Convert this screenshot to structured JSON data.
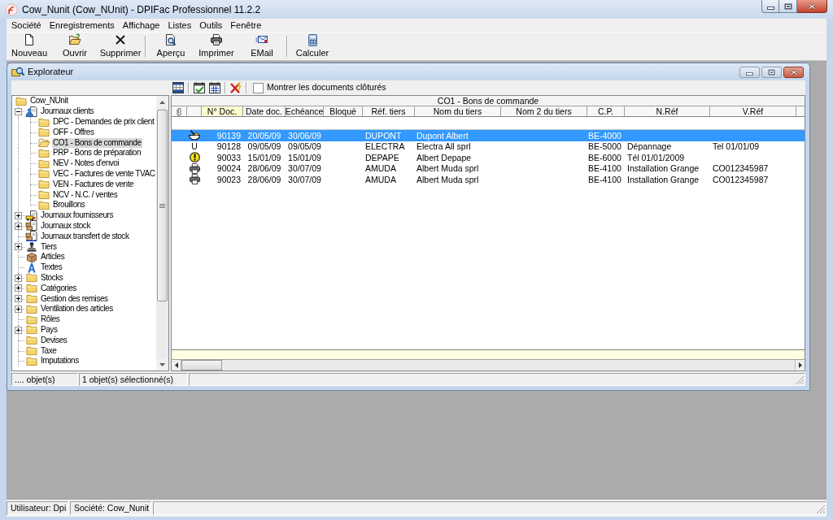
{
  "window": {
    "title": "Cow_Nunit (Cow_NUnit) - DPIFac Professionnel 11.2.2"
  },
  "menu": [
    "Société",
    "Enregistrements",
    "Affichage",
    "Listes",
    "Outils",
    "Fenêtre"
  ],
  "toolbar": [
    [
      {
        "label": "Nouveau",
        "kind": "new"
      },
      {
        "label": "Ouvrir",
        "kind": "open"
      },
      {
        "label": "Supprimer",
        "kind": "delete"
      }
    ],
    [
      {
        "label": "Aperçu",
        "kind": "preview"
      },
      {
        "label": "Imprimer",
        "kind": "print"
      },
      {
        "label": "EMail",
        "kind": "email"
      }
    ],
    [
      {
        "label": "Calculer",
        "kind": "calculator"
      }
    ]
  ],
  "explorer": {
    "title": "Explorateur",
    "toolbar": {
      "show_closed": {
        "label": "Montrer les documents clôturés",
        "checked": false
      }
    },
    "tree": [
      {
        "label": "Cow_NUnit",
        "kind": "folder",
        "selected": false,
        "children": [
          {
            "label": "Journaux clients",
            "kind": "customers",
            "expanded": true,
            "selected": false,
            "children": [
              {
                "label": "DPC - Demandes de prix client",
                "kind": "folder",
                "selected": false
              },
              {
                "label": "OFF - Offres",
                "kind": "folder",
                "selected": false
              },
              {
                "label": "CO1 - Bons de commande",
                "kind": "folder",
                "selected": true
              },
              {
                "label": "PRP - Bons de préparation",
                "kind": "folder",
                "selected": false
              },
              {
                "label": "NEV - Notes d'envoi",
                "kind": "folder",
                "selected": false
              },
              {
                "label": "VEC - Factures de vente TVAC",
                "kind": "folder",
                "selected": false
              },
              {
                "label": "VEN - Factures de vente",
                "kind": "folder",
                "selected": false
              },
              {
                "label": "NCV - N.C. / ventes",
                "kind": "folder",
                "selected": false
              },
              {
                "label": "Brouillons",
                "kind": "folder",
                "selected": false
              }
            ]
          },
          {
            "label": "Journaux fournisseurs",
            "kind": "suppliers",
            "expanded": false,
            "selected": false
          },
          {
            "label": "Journaux stock",
            "kind": "stock",
            "expanded": false,
            "selected": false
          },
          {
            "label": "Journaux transfert de stock",
            "kind": "transfer",
            "selected": false
          },
          {
            "label": "Tiers",
            "kind": "contacts",
            "expanded": false,
            "selected": false
          },
          {
            "label": "Articles",
            "kind": "articles",
            "selected": false
          },
          {
            "label": "Textes",
            "kind": "texts",
            "selected": false
          },
          {
            "label": "Stocks",
            "kind": "folder",
            "expanded": false,
            "selected": false
          },
          {
            "label": "Catégories",
            "kind": "folder",
            "expanded": false,
            "selected": false
          },
          {
            "label": "Gestion des remises",
            "kind": "folder",
            "expanded": false,
            "selected": false
          },
          {
            "label": "Ventilation des articles",
            "kind": "folder",
            "expanded": false,
            "selected": false
          },
          {
            "label": "Rôles",
            "kind": "folder",
            "selected": false
          },
          {
            "label": "Pays",
            "kind": "folder",
            "expanded": false,
            "selected": false
          },
          {
            "label": "Devises",
            "kind": "folder",
            "selected": false
          },
          {
            "label": "Taxe",
            "kind": "folder",
            "selected": false
          },
          {
            "label": "Imputations",
            "kind": "folder",
            "selected": false
          }
        ]
      }
    ],
    "grid": {
      "title": "CO1 - Bons de commande",
      "columns": [
        {
          "label": "N° Doc.",
          "sorted": true
        },
        {
          "label": "Date doc.",
          "sorted": false
        },
        {
          "label": "Echéance",
          "sorted": false
        },
        {
          "label": "Bloqué",
          "sorted": false
        },
        {
          "label": "Réf. tiers",
          "sorted": false
        },
        {
          "label": "Nom du tiers",
          "sorted": false
        },
        {
          "label": "Nom 2 du tiers",
          "sorted": false
        },
        {
          "label": "C.P.",
          "sorted": false
        },
        {
          "label": "N.Réf",
          "sorted": false
        },
        {
          "label": "V.Réf",
          "sorted": false
        }
      ],
      "rows": [
        {
          "kind": "tool",
          "selected": true,
          "cells": [
            "90139",
            "20/05/09",
            "30/06/09",
            null,
            "DUPONT",
            "Dupont Albert",
            null,
            "BE-4000",
            null,
            null
          ]
        },
        {
          "kind": "letter",
          "flag": "U",
          "selected": false,
          "cells": [
            "90128",
            "09/05/09",
            "09/05/09",
            null,
            "ELECTRA",
            "Electra All sprl",
            null,
            "BE-5000",
            "Dépannage",
            "Tel 01/01/09"
          ]
        },
        {
          "kind": "warning",
          "selected": false,
          "cells": [
            "90033",
            "15/01/09",
            "15/01/09",
            null,
            "DEPAPE",
            "Albert Depape",
            null,
            "BE-6000",
            "Tél 01/01/2009",
            null
          ]
        },
        {
          "kind": "printed",
          "selected": false,
          "cells": [
            "90024",
            "28/06/09",
            "30/07/09",
            null,
            "AMUDA",
            "Albert Muda sprl",
            null,
            "BE-4100",
            "Installation Grange",
            "CO012345987"
          ]
        },
        {
          "kind": "printed",
          "selected": false,
          "cells": [
            "90023",
            "28/06/09",
            "30/07/09",
            null,
            "AMUDA",
            "Albert Muda sprl",
            null,
            "BE-4100",
            "Installation Grange",
            "CO012345987"
          ]
        }
      ]
    },
    "status_bar": [
      "....  objet(s)",
      "1 objet(s) sélectionné(s)"
    ]
  },
  "status_bar": [
    "Utilisateur: Dpi",
    "Société: Cow_Nunit"
  ]
}
